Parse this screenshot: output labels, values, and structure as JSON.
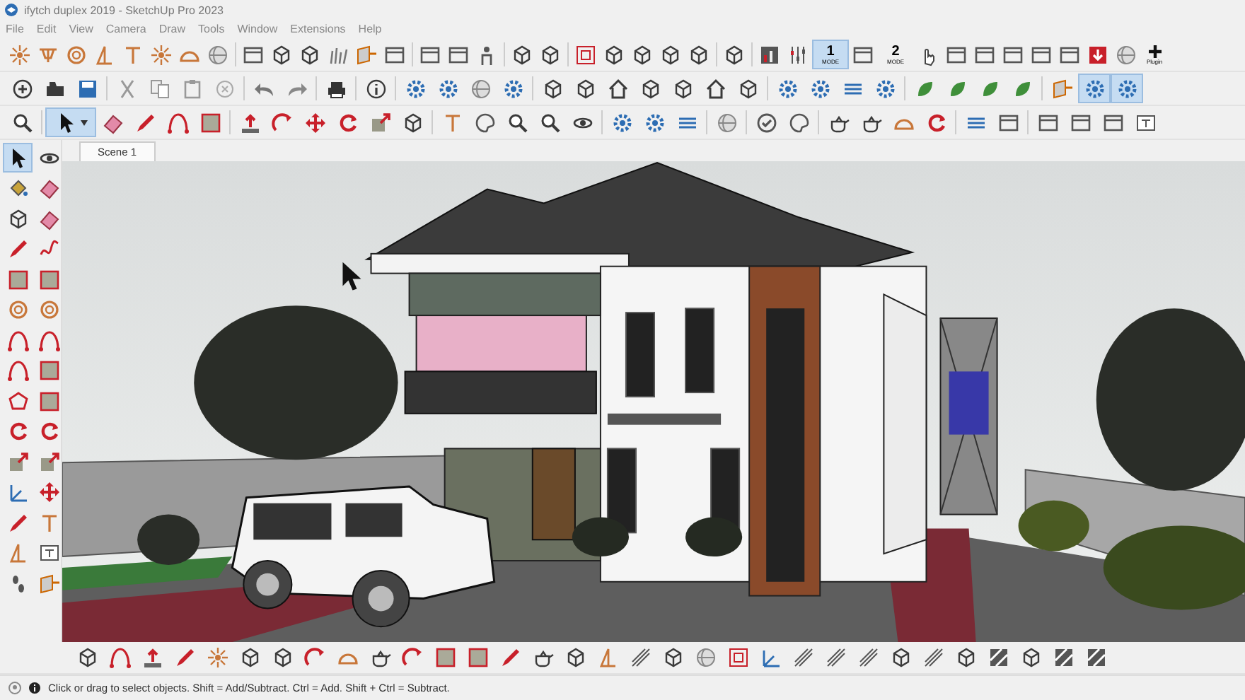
{
  "window": {
    "title": "ifytch duplex  2019 - SketchUp Pro 2023"
  },
  "menu": [
    "File",
    "Edit",
    "View",
    "Camera",
    "Draw",
    "Tools",
    "Window",
    "Extensions",
    "Help"
  ],
  "toolbar": {
    "select_tool": {
      "selected": true
    },
    "mode_buttons": [
      {
        "number": "1",
        "label": "MODE",
        "selected": true
      },
      {
        "number": "2",
        "label": "MODE",
        "selected": false
      }
    ],
    "plugin_button": {
      "label": "Plugin"
    },
    "style_toggles": [
      {
        "selected": false
      },
      {
        "selected": true
      },
      {
        "selected": true
      }
    ]
  },
  "tool_palette": {
    "select_tool": {
      "selected": true
    }
  },
  "scene_tabs": [
    {
      "label": "Scene 1",
      "selected": true
    }
  ],
  "status_bar": {
    "message": "Click or drag to select objects. Shift = Add/Subtract. Ctrl = Add. Shift + Ctrl = Subtract."
  }
}
